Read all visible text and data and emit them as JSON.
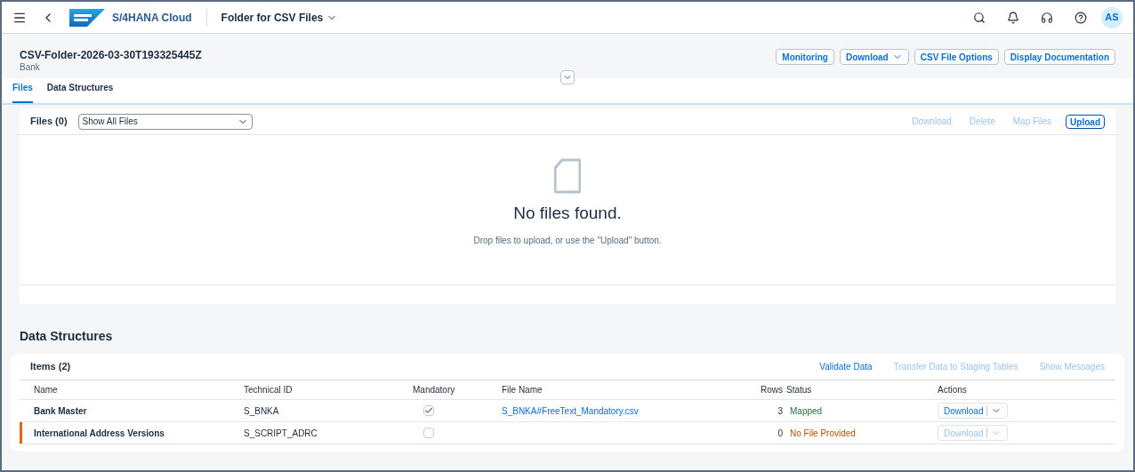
{
  "shell": {
    "product": "S/4HANA Cloud",
    "app_title": "Folder for CSV Files",
    "avatar": "AS"
  },
  "header": {
    "title": "CSV-Folder-2026-03-30T193325445Z",
    "subtitle": "Bank",
    "actions": [
      {
        "label": "Monitoring",
        "menu": false
      },
      {
        "label": "Download",
        "menu": true
      },
      {
        "label": "CSV File Options",
        "menu": false
      },
      {
        "label": "Display Documentation",
        "menu": false
      }
    ]
  },
  "tabs": [
    {
      "label": "Files",
      "selected": true
    },
    {
      "label": "Data Structures",
      "selected": false
    }
  ],
  "files": {
    "title": "Files (0)",
    "filter": "Show All Files",
    "toolbar": [
      {
        "label": "Download",
        "disabled": true
      },
      {
        "label": "Delete",
        "disabled": true
      },
      {
        "label": "Map Files",
        "disabled": true
      },
      {
        "label": "Upload",
        "disabled": false
      }
    ],
    "empty_title": "No files found.",
    "empty_text": "Drop files to upload, or use the \"Upload\" button."
  },
  "data_structures": {
    "heading": "Data Structures",
    "title": "Items (2)",
    "toolbar": [
      {
        "label": "Validate Data",
        "disabled": false
      },
      {
        "label": "Transfer Data to Staging Tables",
        "disabled": true
      },
      {
        "label": "Show Messages",
        "disabled": true
      }
    ],
    "columns": [
      "Name",
      "Technical ID",
      "Mandatory",
      "File Name",
      "Rows",
      "Status",
      "Actions"
    ],
    "rows": [
      {
        "name": "Bank Master",
        "technical_id": "S_BNKA",
        "mandatory": true,
        "file_name": "S_BNKA#FreeText_Mandatory.csv",
        "rows": "3",
        "status": "Mapped",
        "color": "#256f3a",
        "highlight": false,
        "action": "Download",
        "action_disabled": false
      },
      {
        "name": "International Address Versions",
        "technical_id": "S_SCRIPT_ADRC",
        "mandatory": false,
        "file_name": "",
        "rows": "0",
        "status": "No File Provided",
        "color": "#b44f00",
        "highlight": true,
        "action": "Download",
        "action_disabled": true
      }
    ]
  }
}
